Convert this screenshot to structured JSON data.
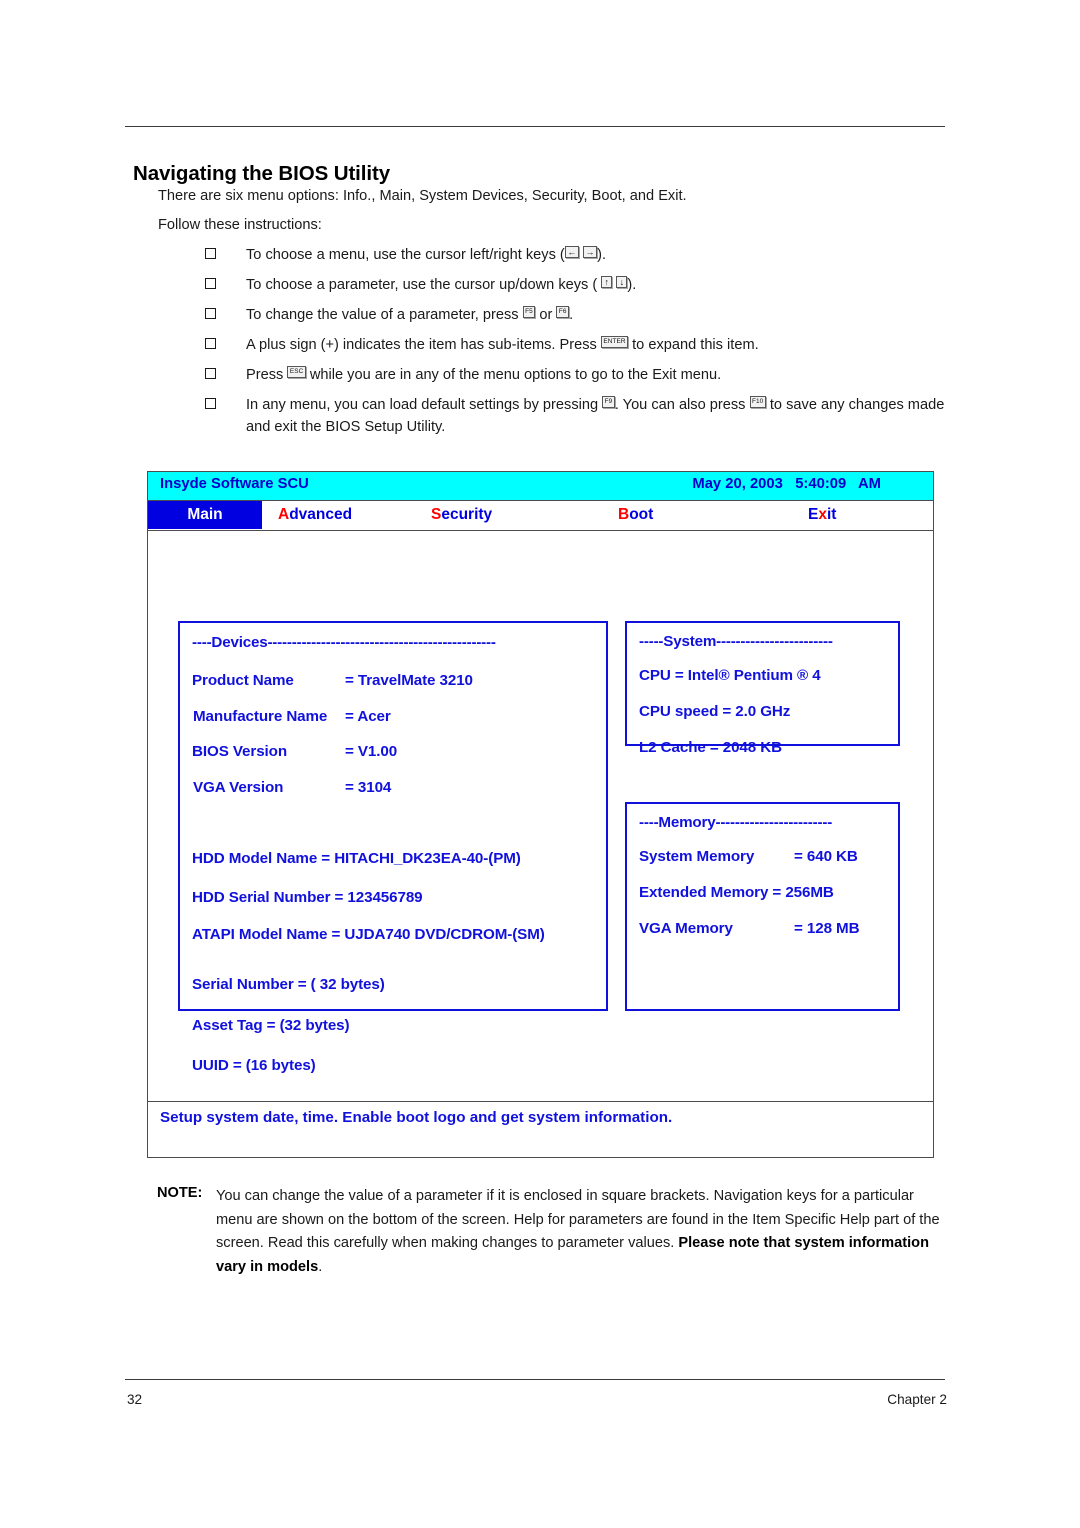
{
  "document": {
    "title": "Navigating the BIOS Utility",
    "intro_line_1": "There are six menu options: Info., Main, System Devices, Security, Boot, and Exit.",
    "intro_line_2": "Follow these instructions:",
    "footer": {
      "page_number": "32",
      "chapter": "Chapter 2"
    }
  },
  "instructions": [
    {
      "before": "To choose a menu, use the cursor left/right keys (",
      "keys": [
        "←",
        "→"
      ],
      "after": ")."
    },
    {
      "before": "To choose a parameter, use the cursor up/down keys ( ",
      "keys": [
        "↑",
        "↓"
      ],
      "after": ")."
    },
    {
      "before": "To change the value of a parameter, press ",
      "keys": [
        "F5"
      ],
      "middle": "or ",
      "keys2": [
        "F6"
      ],
      "after": "."
    },
    {
      "before": "A plus sign (+) indicates the item has sub-items. Press ",
      "keys": [
        "ENTER"
      ],
      "after": " to expand this item."
    },
    {
      "before": "Press ",
      "keys": [
        "ESC"
      ],
      "after": " while you are in any of the menu options to go to the Exit menu."
    },
    {
      "before": "In any menu, you can load default settings by pressing ",
      "keys": [
        "F9"
      ],
      "middle": ". You can also press ",
      "keys2": [
        "F10"
      ],
      "after": " to save any changes made and exit the BIOS Setup Utility."
    }
  ],
  "bios": {
    "titlebar": {
      "product": "Insyde Software SCU",
      "datetime": "May 20, 2003   5:40:09   AM"
    },
    "tabs": [
      {
        "hot": "M",
        "rest": "ain",
        "selected": true
      },
      {
        "hot": "A",
        "rest": "dvanced",
        "selected": false
      },
      {
        "hot": "S",
        "rest": "ecurity",
        "selected": false
      },
      {
        "hot": "B",
        "rest": "oot",
        "selected": false
      },
      {
        "hot": "x",
        "rest": "it",
        "pre": "E",
        "selected": false
      }
    ],
    "panels": {
      "devices": {
        "heading": "----Devices-----------------------------------------------",
        "rows": [
          {
            "key": "Product Name",
            "value": "= TravelMate 3210"
          },
          {
            "key": "Manufacture Name",
            "value": "= Acer"
          },
          {
            "key": "BIOS Version",
            "value": "= V1.00"
          },
          {
            "key": "VGA Version",
            "value": "= 3104"
          }
        ],
        "lines": [
          "HDD Model Name = HITACHI_DK23EA-40-(PM)",
          "HDD Serial Number = 123456789",
          "ATAPI Model Name = UJDA740 DVD/CDROM-(SM)",
          "Serial Number = ( 32 bytes)",
          "Asset Tag = (32 bytes)",
          "UUID = (16 bytes)"
        ]
      },
      "system": {
        "heading": "-----System------------------------",
        "lines": [
          "CPU = Intel® Pentium ® 4",
          "CPU speed = 2.0 GHz",
          "L2 Cache = 2048 KB"
        ]
      },
      "memory": {
        "heading": "----Memory------------------------",
        "rows": [
          {
            "key": "System Memory",
            "value": "= 640 KB"
          },
          {
            "key": "Extended Memory",
            "value": "= 256MB",
            "inline": true
          },
          {
            "key": "VGA Memory",
            "value": "= 128 MB"
          }
        ],
        "extended_line": "Extended Memory = 256MB"
      }
    },
    "status": "Setup system date, time. Enable boot logo and get system information."
  },
  "note": {
    "label": "NOTE:",
    "text_normal_1": "You can change the value of a parameter if it is enclosed in square brackets. Navigation keys for a particular menu are shown on the bottom of the screen. Help for parameters are found in the Item Specific Help part of the screen. Read this carefully when making changes to parameter values. ",
    "text_bold": "Please note that system information vary in models",
    "text_normal_2": "."
  },
  "colors": {
    "titlebar_bg": "#00ffff",
    "bios_blue": "#0000e0",
    "panel_blue": "#1111dd",
    "hotkey_red": "#ff0000",
    "selected_tab_bg": "#0000e0"
  }
}
